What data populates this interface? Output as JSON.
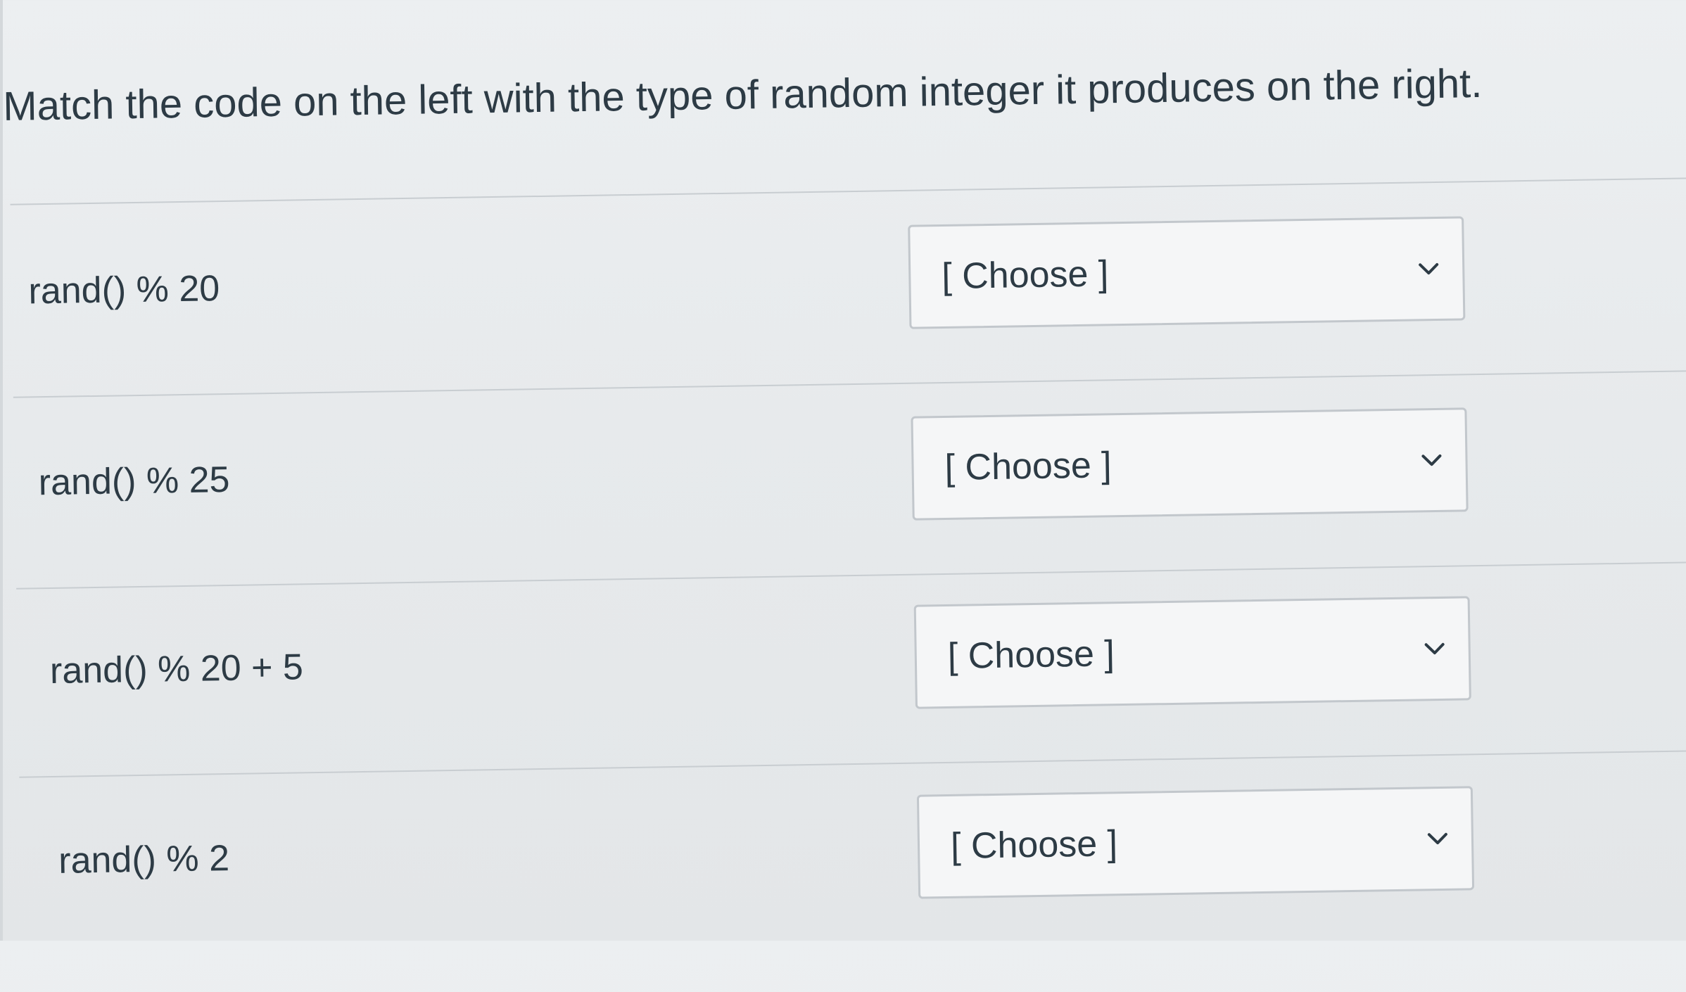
{
  "question": {
    "text": "Match the code on the left with the type of random integer it produces on the right."
  },
  "matches": [
    {
      "prompt": "rand() % 20",
      "selected": "[ Choose ]"
    },
    {
      "prompt": "rand() % 25",
      "selected": "[ Choose ]"
    },
    {
      "prompt": "rand() % 20 + 5",
      "selected": "[ Choose ]"
    },
    {
      "prompt": "rand() % 2",
      "selected": "[ Choose ]"
    }
  ],
  "icons": {
    "dropdown": "chevron-down-icon"
  },
  "colors": {
    "text": "#2d3b45",
    "border": "#c2c7cc",
    "background": "#e9ecee"
  }
}
